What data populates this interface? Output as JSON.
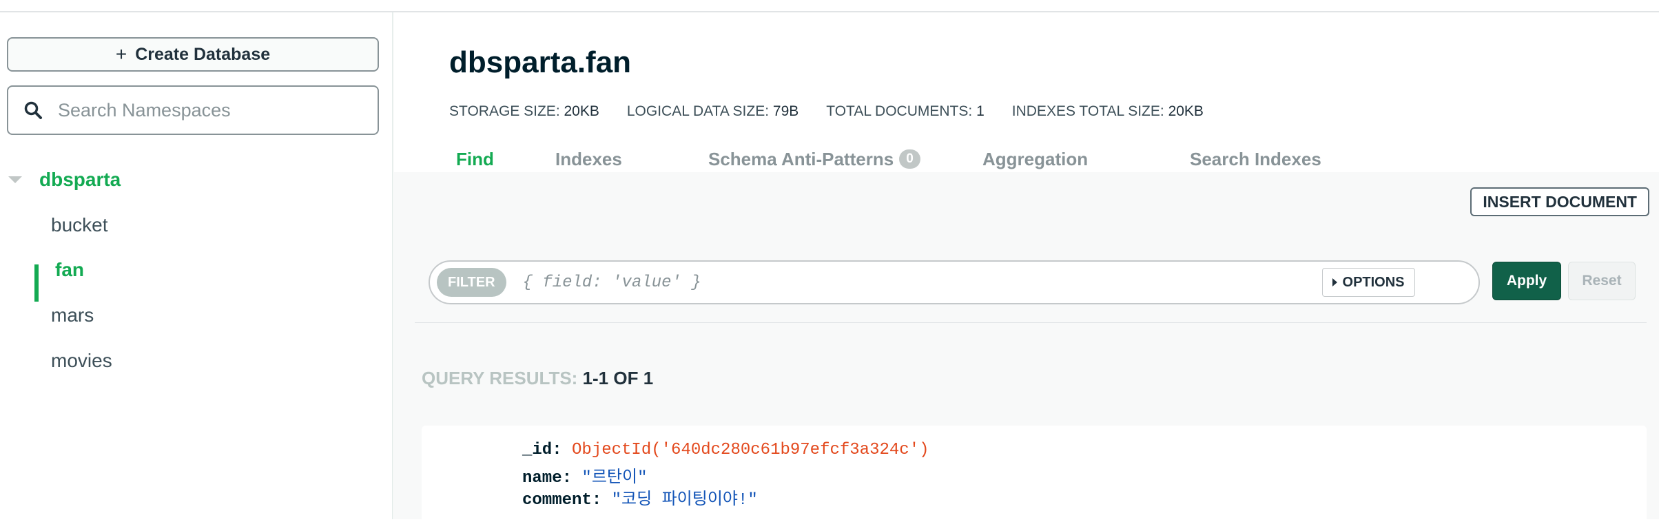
{
  "sidebar": {
    "create_database_label": "Create Database",
    "search_placeholder": "Search Namespaces",
    "database": "dbsparta",
    "collections": [
      "bucket",
      "fan",
      "mars",
      "movies"
    ],
    "active_collection": "fan"
  },
  "main": {
    "title": "dbsparta.fan",
    "stats": [
      {
        "label": "STORAGE SIZE:",
        "value": "20KB"
      },
      {
        "label": "LOGICAL DATA SIZE:",
        "value": "79B"
      },
      {
        "label": "TOTAL DOCUMENTS:",
        "value": "1"
      },
      {
        "label": "INDEXES TOTAL SIZE:",
        "value": "20KB"
      }
    ],
    "tabs": [
      {
        "label": "Find",
        "active": true
      },
      {
        "label": "Indexes"
      },
      {
        "label": "Schema Anti-Patterns",
        "badge": "0"
      },
      {
        "label": "Aggregation"
      },
      {
        "label": "Search Indexes"
      }
    ],
    "insert_document_label": "INSERT DOCUMENT",
    "filter_label": "FILTER",
    "filter_placeholder": "{ field: 'value' }",
    "options_label": "OPTIONS",
    "apply_label": "Apply",
    "reset_label": "Reset",
    "query_results_label": "QUERY RESULTS:",
    "query_results_count": "1-1 OF 1",
    "document": {
      "id_key": "_id:",
      "id_value": "ObjectId('640dc280c61b97efcf3a324c')",
      "name_key": "name:",
      "name_value": "\"르탄이\"",
      "comment_key": "comment:",
      "comment_value": "\"코딩 파이팅이야!\""
    }
  },
  "colors": {
    "accent_green": "#13aa52",
    "apply_button": "#116149",
    "object_id": "#e3491d",
    "string_value": "#1254b7"
  }
}
